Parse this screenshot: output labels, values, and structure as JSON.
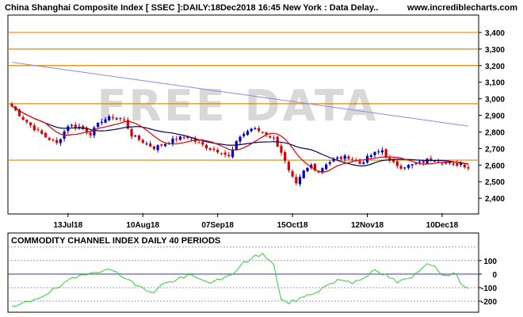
{
  "header": {
    "title": "China Shanghai Composite Index [ SSEC ]:DAILY:18Dec2018 16:45 New York : Data Delay..",
    "site": "www.incrediblecharts.com"
  },
  "watermark": "FREE DATA",
  "colors": {
    "up": "#0000cc",
    "down": "#dd0000",
    "ma_short": "#dd0000",
    "ma_long": "#000066",
    "trendline": "#8888ee",
    "resistance": "#e08a00",
    "cci": "#33cc33",
    "grid": "#9999cc",
    "zero_line": "#3333cc"
  },
  "chart_data": [
    {
      "type": "candlestick",
      "title": "China Shanghai Composite Index [ SSEC ]:DAILY",
      "y_ticks": [
        "2,400",
        "2,500",
        "2,600",
        "2,700",
        "2,800",
        "2,900",
        "3,000",
        "3,100",
        "3,200",
        "3,300",
        "3,400"
      ],
      "y_tick_values": [
        2400,
        2500,
        2600,
        2700,
        2800,
        2900,
        3000,
        3100,
        3200,
        3300,
        3400
      ],
      "ylim": [
        2310,
        3500
      ],
      "x_ticks": [
        {
          "index": 15,
          "label": "13Jul18"
        },
        {
          "index": 35,
          "label": "10Aug18"
        },
        {
          "index": 55,
          "label": "07Sep18"
        },
        {
          "index": 75,
          "label": "15Oct18"
        },
        {
          "index": 95,
          "label": "12Nov18"
        },
        {
          "index": 115,
          "label": "10Dec18"
        }
      ],
      "horizontal_lines": [
        3400,
        3300,
        3200,
        2970,
        2630
      ],
      "trendline": {
        "start": {
          "index": 0,
          "value": 3220
        },
        "end": {
          "index": 122,
          "value": 2835
        }
      },
      "close_keypoints": [
        [
          0,
          2955
        ],
        [
          3,
          2880
        ],
        [
          6,
          2820
        ],
        [
          9,
          2770
        ],
        [
          12,
          2730
        ],
        [
          15,
          2840
        ],
        [
          18,
          2830
        ],
        [
          21,
          2790
        ],
        [
          24,
          2870
        ],
        [
          27,
          2890
        ],
        [
          30,
          2870
        ],
        [
          32,
          2780
        ],
        [
          35,
          2740
        ],
        [
          38,
          2705
        ],
        [
          41,
          2730
        ],
        [
          44,
          2760
        ],
        [
          47,
          2770
        ],
        [
          50,
          2730
        ],
        [
          53,
          2700
        ],
        [
          56,
          2680
        ],
        [
          58,
          2650
        ],
        [
          61,
          2775
        ],
        [
          64,
          2820
        ],
        [
          67,
          2800
        ],
        [
          70,
          2760
        ],
        [
          72,
          2680
        ],
        [
          74,
          2560
        ],
        [
          76,
          2480
        ],
        [
          78,
          2560
        ],
        [
          80,
          2600
        ],
        [
          82,
          2560
        ],
        [
          84,
          2610
        ],
        [
          87,
          2640
        ],
        [
          90,
          2650
        ],
        [
          93,
          2610
        ],
        [
          96,
          2660
        ],
        [
          99,
          2690
        ],
        [
          101,
          2620
        ],
        [
          104,
          2590
        ],
        [
          107,
          2600
        ],
        [
          110,
          2620
        ],
        [
          112,
          2640
        ],
        [
          115,
          2620
        ],
        [
          118,
          2600
        ],
        [
          120,
          2610
        ],
        [
          122,
          2585
        ]
      ],
      "ma_short_period": 10,
      "ma_long_period": 21,
      "series": [
        {
          "name": "",
          "values": "ohlc candles generated from close_keypoints"
        }
      ]
    },
    {
      "type": "line",
      "title": "COMMODITY CHANNEL INDEX DAILY 40 PERIODS",
      "y_ticks": [
        "100",
        "0",
        "-100",
        "-200"
      ],
      "y_tick_values": [
        100,
        0,
        -100,
        -200
      ],
      "ylim": [
        -270,
        210
      ],
      "grid_values": [
        200,
        100,
        -100,
        -200
      ],
      "keypoints": [
        [
          0,
          -250
        ],
        [
          4,
          -210
        ],
        [
          8,
          -160
        ],
        [
          12,
          -105
        ],
        [
          16,
          -40
        ],
        [
          20,
          10
        ],
        [
          24,
          30
        ],
        [
          28,
          20
        ],
        [
          32,
          -60
        ],
        [
          35,
          -110
        ],
        [
          38,
          -130
        ],
        [
          40,
          -80
        ],
        [
          44,
          -40
        ],
        [
          48,
          -10
        ],
        [
          50,
          -40
        ],
        [
          54,
          -60
        ],
        [
          58,
          -20
        ],
        [
          61,
          60
        ],
        [
          64,
          120
        ],
        [
          67,
          150
        ],
        [
          70,
          60
        ],
        [
          72,
          -180
        ],
        [
          74,
          -220
        ],
        [
          76,
          -190
        ],
        [
          79,
          -160
        ],
        [
          82,
          -120
        ],
        [
          85,
          -70
        ],
        [
          88,
          -40
        ],
        [
          91,
          -60
        ],
        [
          94,
          -20
        ],
        [
          97,
          20
        ],
        [
          100,
          -10
        ],
        [
          103,
          -60
        ],
        [
          106,
          -40
        ],
        [
          109,
          20
        ],
        [
          111,
          90
        ],
        [
          113,
          60
        ],
        [
          116,
          -20
        ],
        [
          118,
          10
        ],
        [
          120,
          -60
        ],
        [
          122,
          -100
        ]
      ]
    }
  ]
}
